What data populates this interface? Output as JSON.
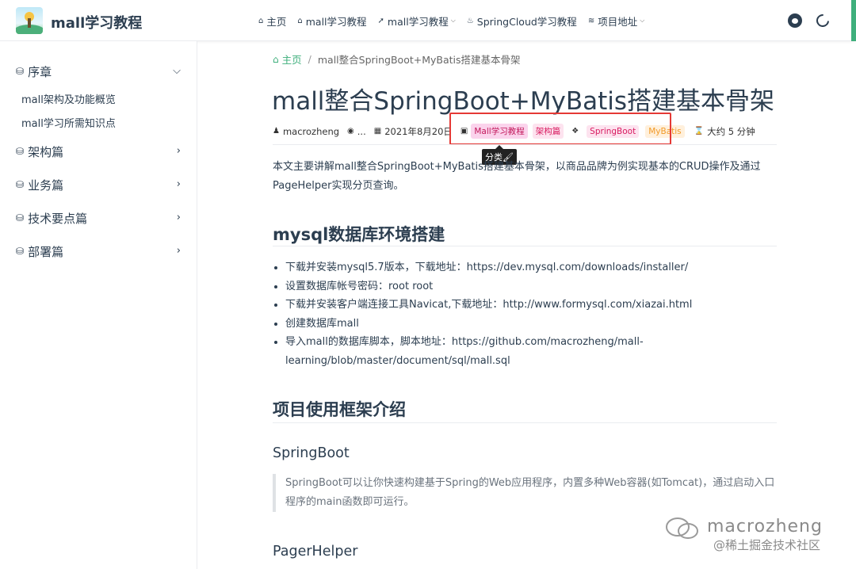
{
  "navbar": {
    "site_name": "mall学习教程",
    "links": [
      {
        "label": "主页",
        "icon": "home-icon",
        "glyph": "⌂",
        "has_caret": false
      },
      {
        "label": "mall学习教程",
        "icon": "home-icon",
        "glyph": "⌂",
        "has_caret": false
      },
      {
        "label": "mall学习教程",
        "icon": "rocket-icon",
        "glyph": "➚",
        "has_caret": true
      },
      {
        "label": "SpringCloud学习教程",
        "icon": "fire-icon",
        "glyph": "♨",
        "has_caret": false
      },
      {
        "label": "项目地址",
        "icon": "stack-icon",
        "glyph": "≋",
        "has_caret": true
      }
    ],
    "caret_glyph": "⌵"
  },
  "sidebar": {
    "groups": [
      {
        "label": "序章",
        "glyph": "⛁",
        "expanded": true,
        "arrow": "⌵"
      },
      {
        "label": "架构篇",
        "glyph": "⛁",
        "expanded": false,
        "arrow": "›"
      },
      {
        "label": "业务篇",
        "glyph": "⛁",
        "expanded": false,
        "arrow": "›"
      },
      {
        "label": "技术要点篇",
        "glyph": "⛁",
        "expanded": false,
        "arrow": "›"
      },
      {
        "label": "部署篇",
        "glyph": "⛁",
        "expanded": false,
        "arrow": "›"
      }
    ],
    "items": [
      "mall架构及功能概览",
      "mall学习所需知识点"
    ]
  },
  "breadcrumb": {
    "home": "主页",
    "separator": "/",
    "current": "mall整合SpringBoot+MyBatis搭建基本骨架"
  },
  "article": {
    "title": "mall整合SpringBoot+MyBatis搭建基本骨架",
    "meta": {
      "author": "macrozheng",
      "views": "...",
      "date": "2021年8月20日",
      "categories": [
        "Mall学习教程",
        "架构篇"
      ],
      "tags": [
        "SpringBoot",
        "MyBatis"
      ],
      "reading_time": "大约 5 分钟",
      "tooltip": "分类🖌"
    },
    "intro": "本文主要讲解mall整合SpringBoot+MyBatis搭建基本骨架，以商品品牌为例实现基本的CRUD操作及通过PageHelper实现分页查询。",
    "section1": {
      "heading": "mysql数据库环境搭建",
      "items": [
        "下载并安装mysql5.7版本，下载地址：https://dev.mysql.com/downloads/installer/",
        "设置数据库帐号密码：root root",
        "下载并安装客户端连接工具Navicat,下载地址：http://www.formysql.com/xiazai.html",
        "创建数据库mall",
        "导入mall的数据库脚本，脚本地址：https://github.com/macrozheng/mall-learning/blob/master/document/sql/mall.sql"
      ]
    },
    "section2": {
      "heading": "项目使用框架介绍",
      "sub1": {
        "heading": "SpringBoot",
        "quote": "SpringBoot可以让你快速构建基于Spring的Web应用程序，内置多种Web容器(如Tomcat)，通过启动入口程序的main函数即可运行。"
      },
      "sub2": {
        "heading": "PagerHelper"
      }
    }
  },
  "watermark": {
    "brand": "macrozheng",
    "site": "@稀土掘金技术社区"
  },
  "colors": {
    "accent": "#3eaf7c",
    "highlight_box": "#e53935"
  }
}
